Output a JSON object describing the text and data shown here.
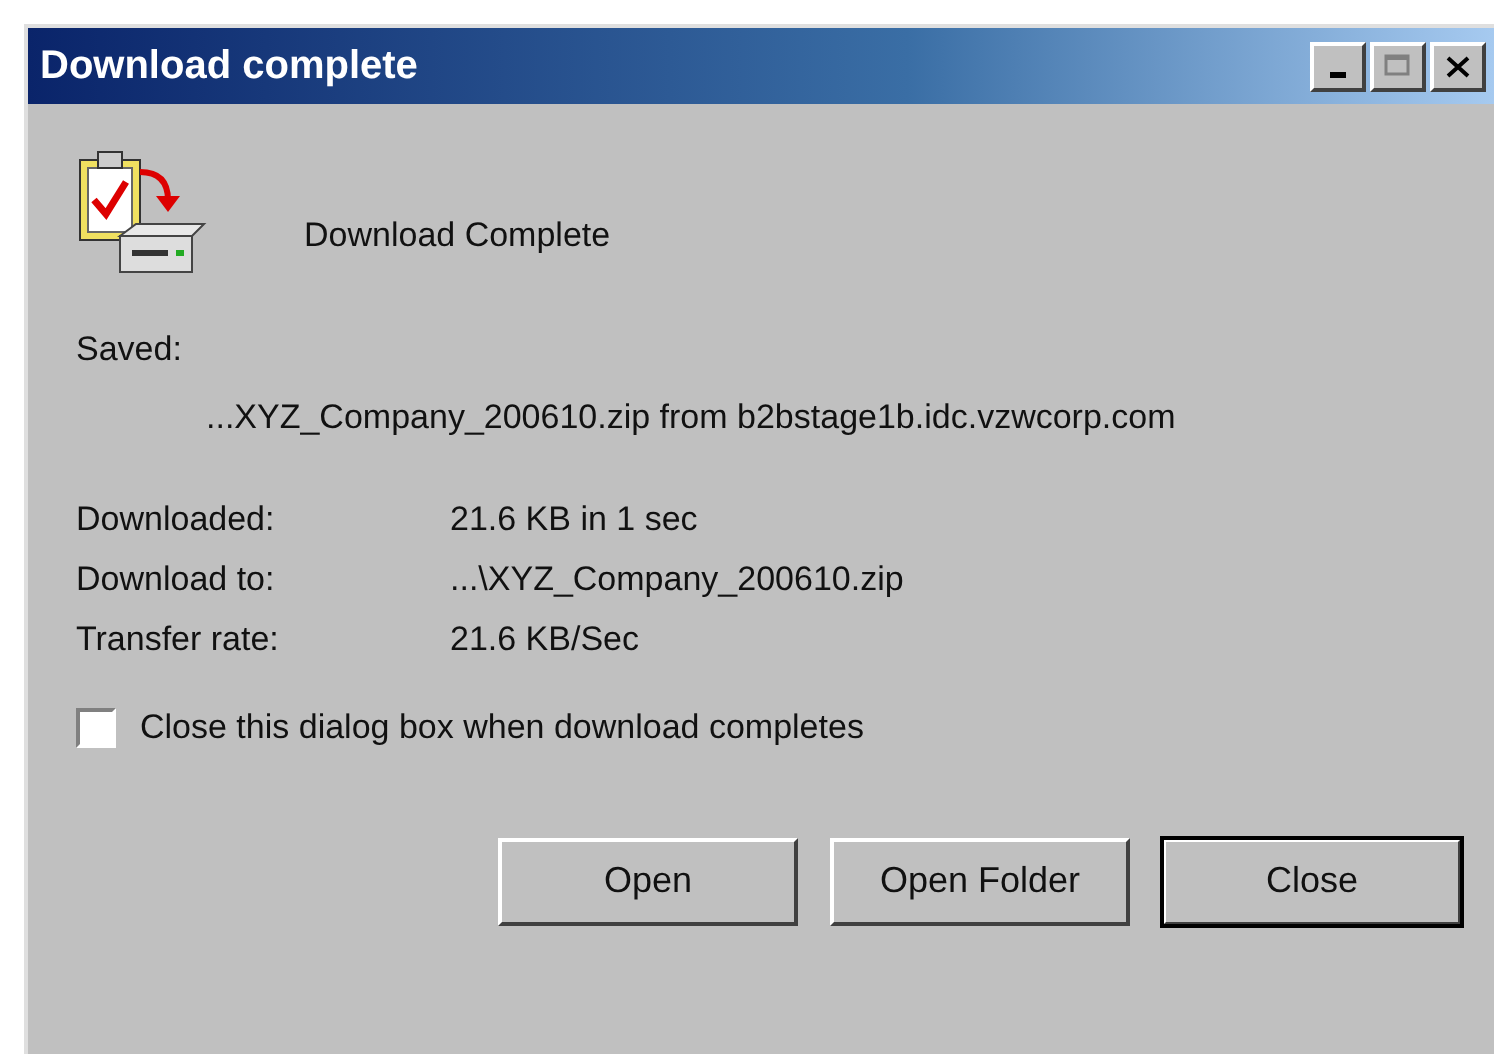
{
  "window": {
    "title": "Download complete"
  },
  "header": {
    "text": "Download Complete"
  },
  "saved": {
    "label": "Saved:",
    "path": "...XYZ_Company_200610.zip from b2bstage1b.idc.vzwcorp.com"
  },
  "details": [
    {
      "label": "Downloaded:",
      "value": "21.6 KB in 1 sec"
    },
    {
      "label": "Download to:",
      "value": "...\\XYZ_Company_200610.zip"
    },
    {
      "label": "Transfer rate:",
      "value": "21.6 KB/Sec"
    }
  ],
  "close_when_done": {
    "label": "Close this dialog box when download completes",
    "checked": false
  },
  "buttons": [
    {
      "label": "Open",
      "default": false
    },
    {
      "label": "Open Folder",
      "default": false
    },
    {
      "label": "Close",
      "default": true
    }
  ]
}
